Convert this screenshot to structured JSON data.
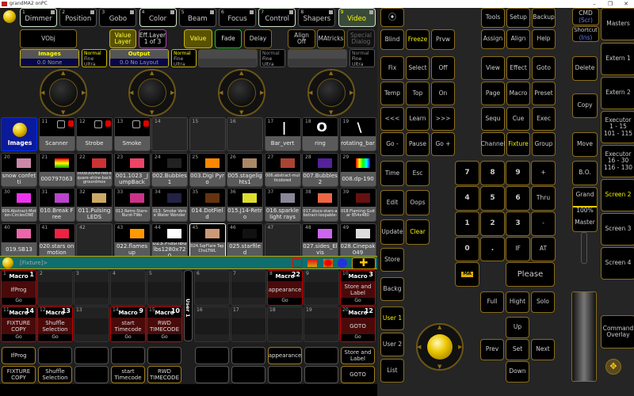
{
  "window": {
    "title": "grandMA2 onPC",
    "minimize": "–",
    "restore": "❐",
    "close": "✕"
  },
  "preset_tabs": [
    {
      "num": "1",
      "label": "Dimmer"
    },
    {
      "num": "2",
      "label": "Position"
    },
    {
      "num": "3",
      "label": "Gobo"
    },
    {
      "num": "4",
      "label": "Color"
    },
    {
      "num": "5",
      "label": "Beam"
    },
    {
      "num": "6",
      "label": "Focus"
    },
    {
      "num": "7",
      "label": "Control"
    },
    {
      "num": "8",
      "label": "Shapers"
    },
    {
      "num": "9",
      "label": "Video",
      "active": true
    }
  ],
  "toolbar": {
    "vobj": "VObj",
    "value_layer": "Value\nLayer",
    "eff_layer": "Eff.Layer\n1 of 3",
    "value": "Value",
    "fade": "Fade",
    "delay": "Delay",
    "align": "Align\nOff",
    "matricks": "MAtricks",
    "special_dialog": "Special\nDialog"
  },
  "encoders": [
    {
      "title": "Images",
      "value": "0.0 None",
      "res": [
        "Normal",
        "Fine",
        "Ultra"
      ]
    },
    {
      "title": "Output",
      "value": "0.0 No Layout",
      "res": [
        "Normal",
        "Fine",
        "Ultra"
      ]
    },
    {
      "title": "",
      "value": "",
      "res": [
        "Normal",
        "Fine",
        "Ultra"
      ]
    },
    {
      "title": "",
      "value": "",
      "res": [
        "Normal",
        "Fine",
        "Ultra"
      ]
    }
  ],
  "pool": [
    {
      "num": "",
      "label": "Images",
      "type": "title"
    },
    {
      "num": "11",
      "label": "Scanner",
      "locked": true
    },
    {
      "num": "12",
      "label": "Strobe",
      "locked": true
    },
    {
      "num": "13",
      "label": "Smoke",
      "locked": true
    },
    {
      "num": "14",
      "label": ""
    },
    {
      "num": "15",
      "label": ""
    },
    {
      "num": "16",
      "label": ""
    },
    {
      "num": "17",
      "label": "Bar_vert",
      "glyph": "|"
    },
    {
      "num": "18",
      "label": "ring",
      "glyph": "O"
    },
    {
      "num": "19",
      "label": "rotating_bar",
      "glyph": "\\"
    },
    {
      "num": "20",
      "label": "snow confetti"
    },
    {
      "num": "21",
      "label": "000797063"
    },
    {
      "num": "22",
      "label": "000830049-red-square-shine-backgroundmos",
      "small": true
    },
    {
      "num": "23",
      "label": "001.1023 _JumpBack"
    },
    {
      "num": "24",
      "label": "002.Bubbles 1"
    },
    {
      "num": "25",
      "label": "003.Digi Pyro"
    },
    {
      "num": "26",
      "label": "005.stagelights1"
    },
    {
      "num": "27",
      "label": "006.abstract-multicolored",
      "small": true
    },
    {
      "num": "28",
      "label": "007.Bubbles 2"
    },
    {
      "num": "29",
      "label": "008.dp-190"
    },
    {
      "num": "30",
      "label": "009.Abstract-Motion-CirclesONE",
      "small": true
    },
    {
      "num": "31",
      "label": "010.Break Free"
    },
    {
      "num": "32",
      "label": "011.Pulsing LEDS"
    },
    {
      "num": "33",
      "label": "012.Retro-Stars-Burst-TWo",
      "small": true
    },
    {
      "num": "34",
      "label": "013. Smoke Verse Water Wonder",
      "small": true
    },
    {
      "num": "35",
      "label": "014.DotField"
    },
    {
      "num": "36",
      "label": "015.J14-Retro"
    },
    {
      "num": "37",
      "label": "016.sparkle light rays"
    },
    {
      "num": "38",
      "label": "017.disco-stars-abstract-loopable-",
      "small": true
    },
    {
      "num": "39",
      "label": "018.Flaming Guitar 854x480",
      "small": true
    },
    {
      "num": "40",
      "label": "019.SB13"
    },
    {
      "num": "41",
      "label": "020.stars on motion"
    },
    {
      "num": "42",
      "label": ""
    },
    {
      "num": "43",
      "label": "022.flames up"
    },
    {
      "num": "44",
      "label": "023.FlashBulbs1280x720"
    },
    {
      "num": "45",
      "label": "024.SqrFlare TapChsLTWL",
      "selected": true,
      "small": true
    },
    {
      "num": "46",
      "label": "025.starfiled"
    },
    {
      "num": "47",
      "label": ""
    },
    {
      "num": "48",
      "label": "027.sides_Elvis"
    },
    {
      "num": "49",
      "label": "028.Cinepak049"
    }
  ],
  "command_line": {
    "prompt": "[Fixture]>"
  },
  "executors": {
    "page_label": "User 1",
    "macro_label": "Macro",
    "go_label": "Go",
    "items": [
      {
        "num": "1",
        "macro": "1",
        "name": "IfProg"
      },
      {
        "num": "2"
      },
      {
        "num": "3"
      },
      {
        "num": "4"
      },
      {
        "num": "5"
      },
      {
        "num": "6"
      },
      {
        "num": "7"
      },
      {
        "num": "8",
        "macro": "22",
        "name": "appearance"
      },
      {
        "num": "9"
      },
      {
        "num": "10",
        "macro": "3",
        "name": "Store and Label"
      },
      {
        "num": "11",
        "macro": "14",
        "name": "FIXTURE COPY"
      },
      {
        "num": "12",
        "macro": "13",
        "name": "Shuffle Selection"
      },
      {
        "num": "13"
      },
      {
        "num": "14",
        "macro": "9",
        "name": "start Timecode"
      },
      {
        "num": "15",
        "macro": "10",
        "name": "RWD TIMECODE"
      },
      {
        "num": "16"
      },
      {
        "num": "17"
      },
      {
        "num": "18"
      },
      {
        "num": "19"
      },
      {
        "num": "20",
        "macro": "12",
        "name": "GOTO"
      }
    ]
  },
  "exec_buttons": [
    "IfProg",
    "",
    "",
    "",
    "",
    "",
    "",
    "appearance",
    "",
    "Store and Label",
    "FIXTURE COPY",
    "Shuffle Selection",
    "",
    "start Timecode",
    "RWD TIMECODE",
    "",
    "",
    "",
    "",
    "GOTO"
  ],
  "keys": {
    "row_a": [
      "⦿"
    ],
    "row_b": [
      "Blind",
      "Freeze",
      "Prvw"
    ],
    "fix": [
      "Fix",
      "Select",
      "Off",
      "Temp",
      "Top",
      "On",
      "<<<",
      "Learn",
      ">>>",
      "Go -",
      "Pause",
      "Go +"
    ],
    "tools": [
      "Tools",
      "Setup",
      "Backup",
      "Assign",
      "Align",
      "Help"
    ],
    "views": [
      "View",
      "Effect",
      "Goto",
      "Page",
      "Macro",
      "Preset",
      "Sequ",
      "Cue",
      "Exec",
      "Channel",
      "Fixture",
      "Group"
    ],
    "side": [
      "Time",
      "Esc",
      "Edit",
      "Oops",
      "Update",
      "Clear"
    ],
    "col": [
      "Store",
      "Backg",
      "User 1",
      "User 2",
      "List"
    ],
    "numpad": [
      "7",
      "8",
      "9",
      "+",
      "4",
      "5",
      "6",
      "Thru",
      "1",
      "2",
      "3",
      "-",
      "0",
      ".",
      "IF",
      "AT"
    ],
    "ma": "MA",
    "please": "Please",
    "delete": "Delete",
    "copy": "Copy",
    "move": "Move",
    "bo": "B.O.",
    "grand_master": {
      "top": "Grand",
      "value": "100%",
      "bottom": "Master",
      "level_percent": 100
    },
    "cmd": "CMD",
    "cmd_sub": "(Scr)",
    "shortcut": "Shortcut",
    "shortcut_sub": "(Ins)",
    "screens": [
      "Masters",
      "Extern 1",
      "Extern 2",
      "Executor\n1 - 15\n101 - 115",
      "Executor\n16 - 30\n116 - 130",
      "Screen 2",
      "Screen 3",
      "Screen 4"
    ],
    "command_overlay": "Command\nOverlay",
    "nav": [
      "Full",
      "Hight",
      "Solo",
      "Up",
      "Prev",
      "Set",
      "Next",
      "Down"
    ]
  },
  "colors": {
    "accent": "#8a6d1a",
    "highlight": "#f0f000",
    "command_line": "#0f6e6e"
  }
}
